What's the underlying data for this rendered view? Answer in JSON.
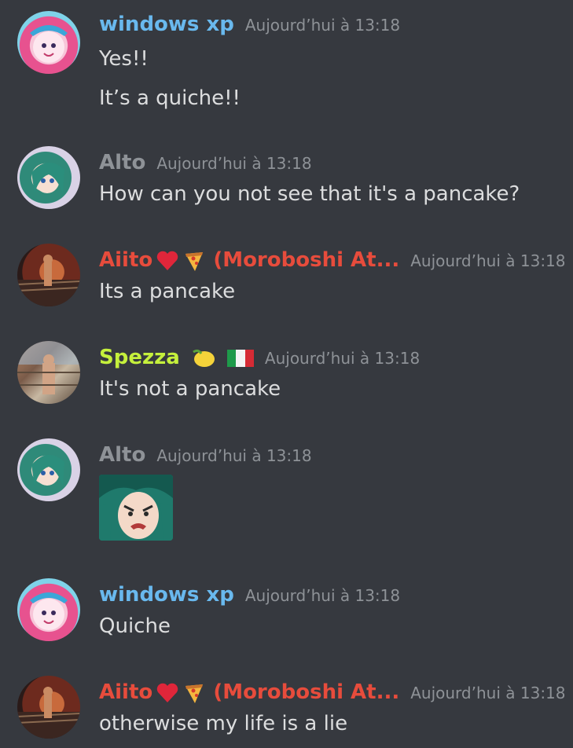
{
  "messages": [
    {
      "author": "windows xp",
      "author_color": "#69b9ee",
      "timestamp": "Aujourd’hui à 13:18",
      "lines": [
        "Yes!!",
        "It’s a quiche!!"
      ]
    },
    {
      "author": "Alto",
      "author_color": "#8e9297",
      "timestamp": "Aujourd’hui à 13:18",
      "lines": [
        "How can you not see that it's a pancake?"
      ]
    },
    {
      "author": "Aiito",
      "author_suffix": "(Moroboshi At...",
      "author_color": "#e74c3c",
      "timestamp": "Aujourd’hui à 13:18",
      "lines": [
        "Its a pancake"
      ]
    },
    {
      "author": "Spezza",
      "author_color": "#c5f03c",
      "timestamp": "Aujourd’hui à 13:18",
      "lines": [
        "It's not a pancake"
      ]
    },
    {
      "author": "Alto",
      "author_color": "#8e9297",
      "timestamp": "Aujourd’hui à 13:18",
      "lines": []
    },
    {
      "author": "windows xp",
      "author_color": "#69b9ee",
      "timestamp": "Aujourd’hui à 13:18",
      "lines": [
        "Quiche"
      ]
    },
    {
      "author": "Aiito",
      "author_suffix": "(Moroboshi At...",
      "author_color": "#e74c3c",
      "timestamp": "Aujourd’hui à 13:18",
      "lines": [
        "otherwise my life is a lie"
      ]
    }
  ],
  "icons": {
    "heart": "heart-emoji-icon",
    "pizza": "pizza-emoji-icon",
    "lemon": "lemon-emoji-icon",
    "flag": "italy-flag-emoji-icon"
  }
}
